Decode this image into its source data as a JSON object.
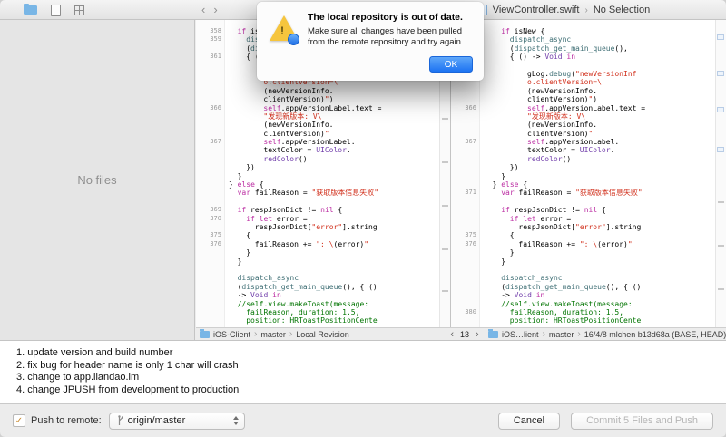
{
  "colors": {
    "accent_blue": "#2f80f2",
    "warning_yellow": "#f6c53d",
    "keyword_pink": "#BB2CA2",
    "string_red": "#D12F1B",
    "comment_green": "#007400",
    "type_purple": "#703DAA",
    "function_teal": "#3E6E74"
  },
  "icons": {
    "chevron": "›",
    "nav_back": "‹",
    "nav_forward": "›",
    "check": "✓",
    "warning_bang": "!"
  },
  "toolbar": {
    "breadcrumb_right": {
      "file": "ViewController.swift",
      "selection": "No Selection"
    }
  },
  "alert": {
    "title": "The local repository is out of date.",
    "message": "Make sure all changes have been pulled from the remote repository and try again.",
    "ok_label": "OK"
  },
  "sidebar": {
    "empty_text": "No files"
  },
  "code_rows": [
    {
      "l": "358",
      "r": "",
      "ind": 2,
      "seg": [
        [
          "if ",
          "k"
        ],
        [
          "isNew {",
          "p"
        ]
      ]
    },
    {
      "l": "359",
      "r": "",
      "ind": 4,
      "seg": [
        [
          "dispatch_async",
          "f"
        ]
      ]
    },
    {
      "l": "",
      "r": "",
      "ind": 4,
      "seg": [
        [
          "(",
          "p"
        ],
        [
          "dispatch_get_main_queue",
          "f"
        ],
        [
          "(),",
          "p"
        ]
      ]
    },
    {
      "l": "361",
      "r": "",
      "ind": 4,
      "seg": [
        [
          "{ () -> ",
          "p"
        ],
        [
          "Void",
          "t"
        ],
        [
          " ",
          "p"
        ],
        [
          "in",
          "k"
        ]
      ]
    },
    {
      "l": "",
      "r": "",
      "ind": 0,
      "seg": []
    },
    {
      "l": "",
      "r": "",
      "ind": 8,
      "seg": [
        [
          "gLog.",
          "p"
        ],
        [
          "debug",
          "f"
        ],
        [
          "(",
          "p"
        ],
        [
          "\"newVersionInf",
          "s"
        ]
      ]
    },
    {
      "l": "",
      "r": "",
      "ind": 8,
      "seg": [
        [
          "o.clientVersion=\\",
          "s"
        ]
      ]
    },
    {
      "l": "",
      "r": "",
      "ind": 8,
      "seg": [
        [
          "(newVersionInfo.",
          "p"
        ]
      ]
    },
    {
      "l": "",
      "r": "",
      "ind": 8,
      "seg": [
        [
          "clientVersion)",
          "p"
        ],
        [
          "\"",
          "s"
        ],
        [
          ")",
          "p"
        ]
      ]
    },
    {
      "l": "366",
      "r": "366",
      "ind": 8,
      "seg": [
        [
          "self",
          "k"
        ],
        [
          ".appVersionLabel.text =",
          "p"
        ]
      ]
    },
    {
      "l": "",
      "r": "",
      "ind": 8,
      "seg": [
        [
          "\"发现新版本: V\\",
          "s"
        ]
      ]
    },
    {
      "l": "",
      "r": "",
      "ind": 8,
      "seg": [
        [
          "(newVersionInfo.",
          "p"
        ]
      ]
    },
    {
      "l": "",
      "r": "",
      "ind": 8,
      "seg": [
        [
          "clientVersion)",
          "p"
        ],
        [
          "\"",
          "s"
        ]
      ]
    },
    {
      "l": "367",
      "r": "367",
      "ind": 8,
      "seg": [
        [
          "self",
          "k"
        ],
        [
          ".appVersionLabel.",
          "p"
        ]
      ]
    },
    {
      "l": "",
      "r": "",
      "ind": 8,
      "seg": [
        [
          "textColor = ",
          "p"
        ],
        [
          "UIColor",
          "t"
        ],
        [
          ".",
          "p"
        ]
      ]
    },
    {
      "l": "",
      "r": "",
      "ind": 8,
      "seg": [
        [
          "redColor",
          "t"
        ],
        [
          "()",
          "p"
        ]
      ]
    },
    {
      "l": "",
      "r": "",
      "ind": 4,
      "seg": [
        [
          "})",
          "p"
        ]
      ]
    },
    {
      "l": "",
      "r": "",
      "ind": 2,
      "seg": [
        [
          "}",
          "p"
        ]
      ]
    },
    {
      "l": "",
      "r": "",
      "ind": 0,
      "seg": [
        [
          "} ",
          "p"
        ],
        [
          "else",
          "k"
        ],
        [
          " {",
          "p"
        ]
      ]
    },
    {
      "l": "",
      "r": "371",
      "ind": 2,
      "seg": [
        [
          "var",
          "k"
        ],
        [
          " failReason = ",
          "p"
        ],
        [
          "\"获取版本信息失败\"",
          "s"
        ]
      ]
    },
    {
      "l": "",
      "r": "",
      "ind": 0,
      "seg": []
    },
    {
      "l": "369",
      "r": "",
      "ind": 2,
      "seg": [
        [
          "if",
          "k"
        ],
        [
          " respJsonDict != ",
          "p"
        ],
        [
          "nil",
          "k"
        ],
        [
          " {",
          "p"
        ]
      ]
    },
    {
      "l": "370",
      "r": "",
      "ind": 4,
      "seg": [
        [
          "if",
          "k"
        ],
        [
          " ",
          "p"
        ],
        [
          "let",
          "k"
        ],
        [
          " error =",
          "p"
        ]
      ]
    },
    {
      "l": "",
      "r": "",
      "ind": 6,
      "seg": [
        [
          "respJsonDict[",
          "p"
        ],
        [
          "\"error\"",
          "s"
        ],
        [
          "].string",
          "p"
        ]
      ]
    },
    {
      "l": "375",
      "r": "375",
      "ind": 4,
      "seg": [
        [
          "{",
          "p"
        ]
      ]
    },
    {
      "l": "376",
      "r": "376",
      "ind": 6,
      "seg": [
        [
          "failReason += ",
          "p"
        ],
        [
          "\": \\",
          "s"
        ],
        [
          "(error)",
          "p"
        ],
        [
          "\"",
          "s"
        ]
      ]
    },
    {
      "l": "",
      "r": "",
      "ind": 4,
      "seg": [
        [
          "}",
          "p"
        ]
      ]
    },
    {
      "l": "",
      "r": "",
      "ind": 2,
      "seg": [
        [
          "}",
          "p"
        ]
      ]
    },
    {
      "l": "",
      "r": "",
      "ind": 0,
      "seg": []
    },
    {
      "l": "",
      "r": "",
      "ind": 2,
      "seg": [
        [
          "dispatch_async",
          "f"
        ]
      ]
    },
    {
      "l": "",
      "r": "",
      "ind": 2,
      "seg": [
        [
          "(",
          "p"
        ],
        [
          "dispatch_get_main_queue",
          "f"
        ],
        [
          "(), { ()",
          "p"
        ]
      ]
    },
    {
      "l": "",
      "r": "",
      "ind": 2,
      "seg": [
        [
          "-> ",
          "p"
        ],
        [
          "Void",
          "t"
        ],
        [
          " ",
          "p"
        ],
        [
          "in",
          "k"
        ]
      ]
    },
    {
      "l": "",
      "r": "",
      "ind": 2,
      "seg": [
        [
          "//self.view.makeToast(message:",
          "c"
        ]
      ]
    },
    {
      "l": "",
      "r": "380",
      "ind": 4,
      "seg": [
        [
          "failReason, duration: 1.5,",
          "c"
        ]
      ]
    },
    {
      "l": "",
      "r": "",
      "ind": 4,
      "seg": [
        [
          "position: HRToastPositionCente",
          "c"
        ]
      ]
    }
  ],
  "jumpbar_left": {
    "items": [
      "iOS-Client",
      "master",
      "Local Revision"
    ]
  },
  "pager": {
    "count": "13"
  },
  "jumpbar_right": {
    "items": [
      "iOS…lient",
      "master",
      "16/4/8  mlchen  b13d68a (BASE, HEAD)"
    ]
  },
  "commit": {
    "lines": [
      "1. update version and build number",
      "2. fix bug for header name is only 1 char will crash",
      "3. change to app.liandao.im",
      "4. change JPUSH from development to production"
    ]
  },
  "footer": {
    "push_label": "Push to remote:",
    "remote_value": "origin/master",
    "cancel_label": "Cancel",
    "commit_label": "Commit 5 Files and Push"
  }
}
